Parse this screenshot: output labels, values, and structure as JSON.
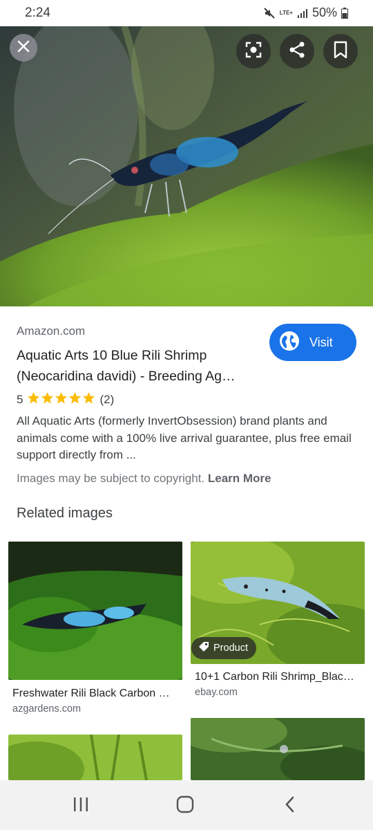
{
  "status_bar": {
    "time": "2:24",
    "network": "LTE+",
    "battery": "50%"
  },
  "hero": {
    "actions": [
      "close-icon",
      "google-lens-icon",
      "share-icon",
      "bookmark-icon"
    ]
  },
  "result": {
    "source": "Amazon.com",
    "title": "Aquatic Arts 10 Blue Rili Shrimp (Neocaridina davidi) - Breeding Ag…",
    "visit_label": "Visit",
    "rating": "5",
    "stars": 5,
    "rating_count": "(2)",
    "description": "All Aquatic Arts (formerly InvertObsession) brand plants and animals come with a 100% live arrival guarantee, plus free email support directly from ...",
    "copyright_text": "Images may be subject to copyright.",
    "learn_more": "Learn More"
  },
  "related": {
    "heading": "Related images",
    "items": [
      {
        "caption": "Freshwater Rili Black Carbon …",
        "domain": "azgardens.com"
      },
      {
        "caption": "10+1 Carbon Rili Shrimp_Blac…",
        "domain": "ebay.com",
        "badge": "Product"
      }
    ]
  },
  "colors": {
    "visit_button": "#1a73e8",
    "star": "#fbbc04"
  },
  "nav_bar": {
    "items": [
      "recent-apps-icon",
      "home-icon",
      "back-icon"
    ]
  }
}
